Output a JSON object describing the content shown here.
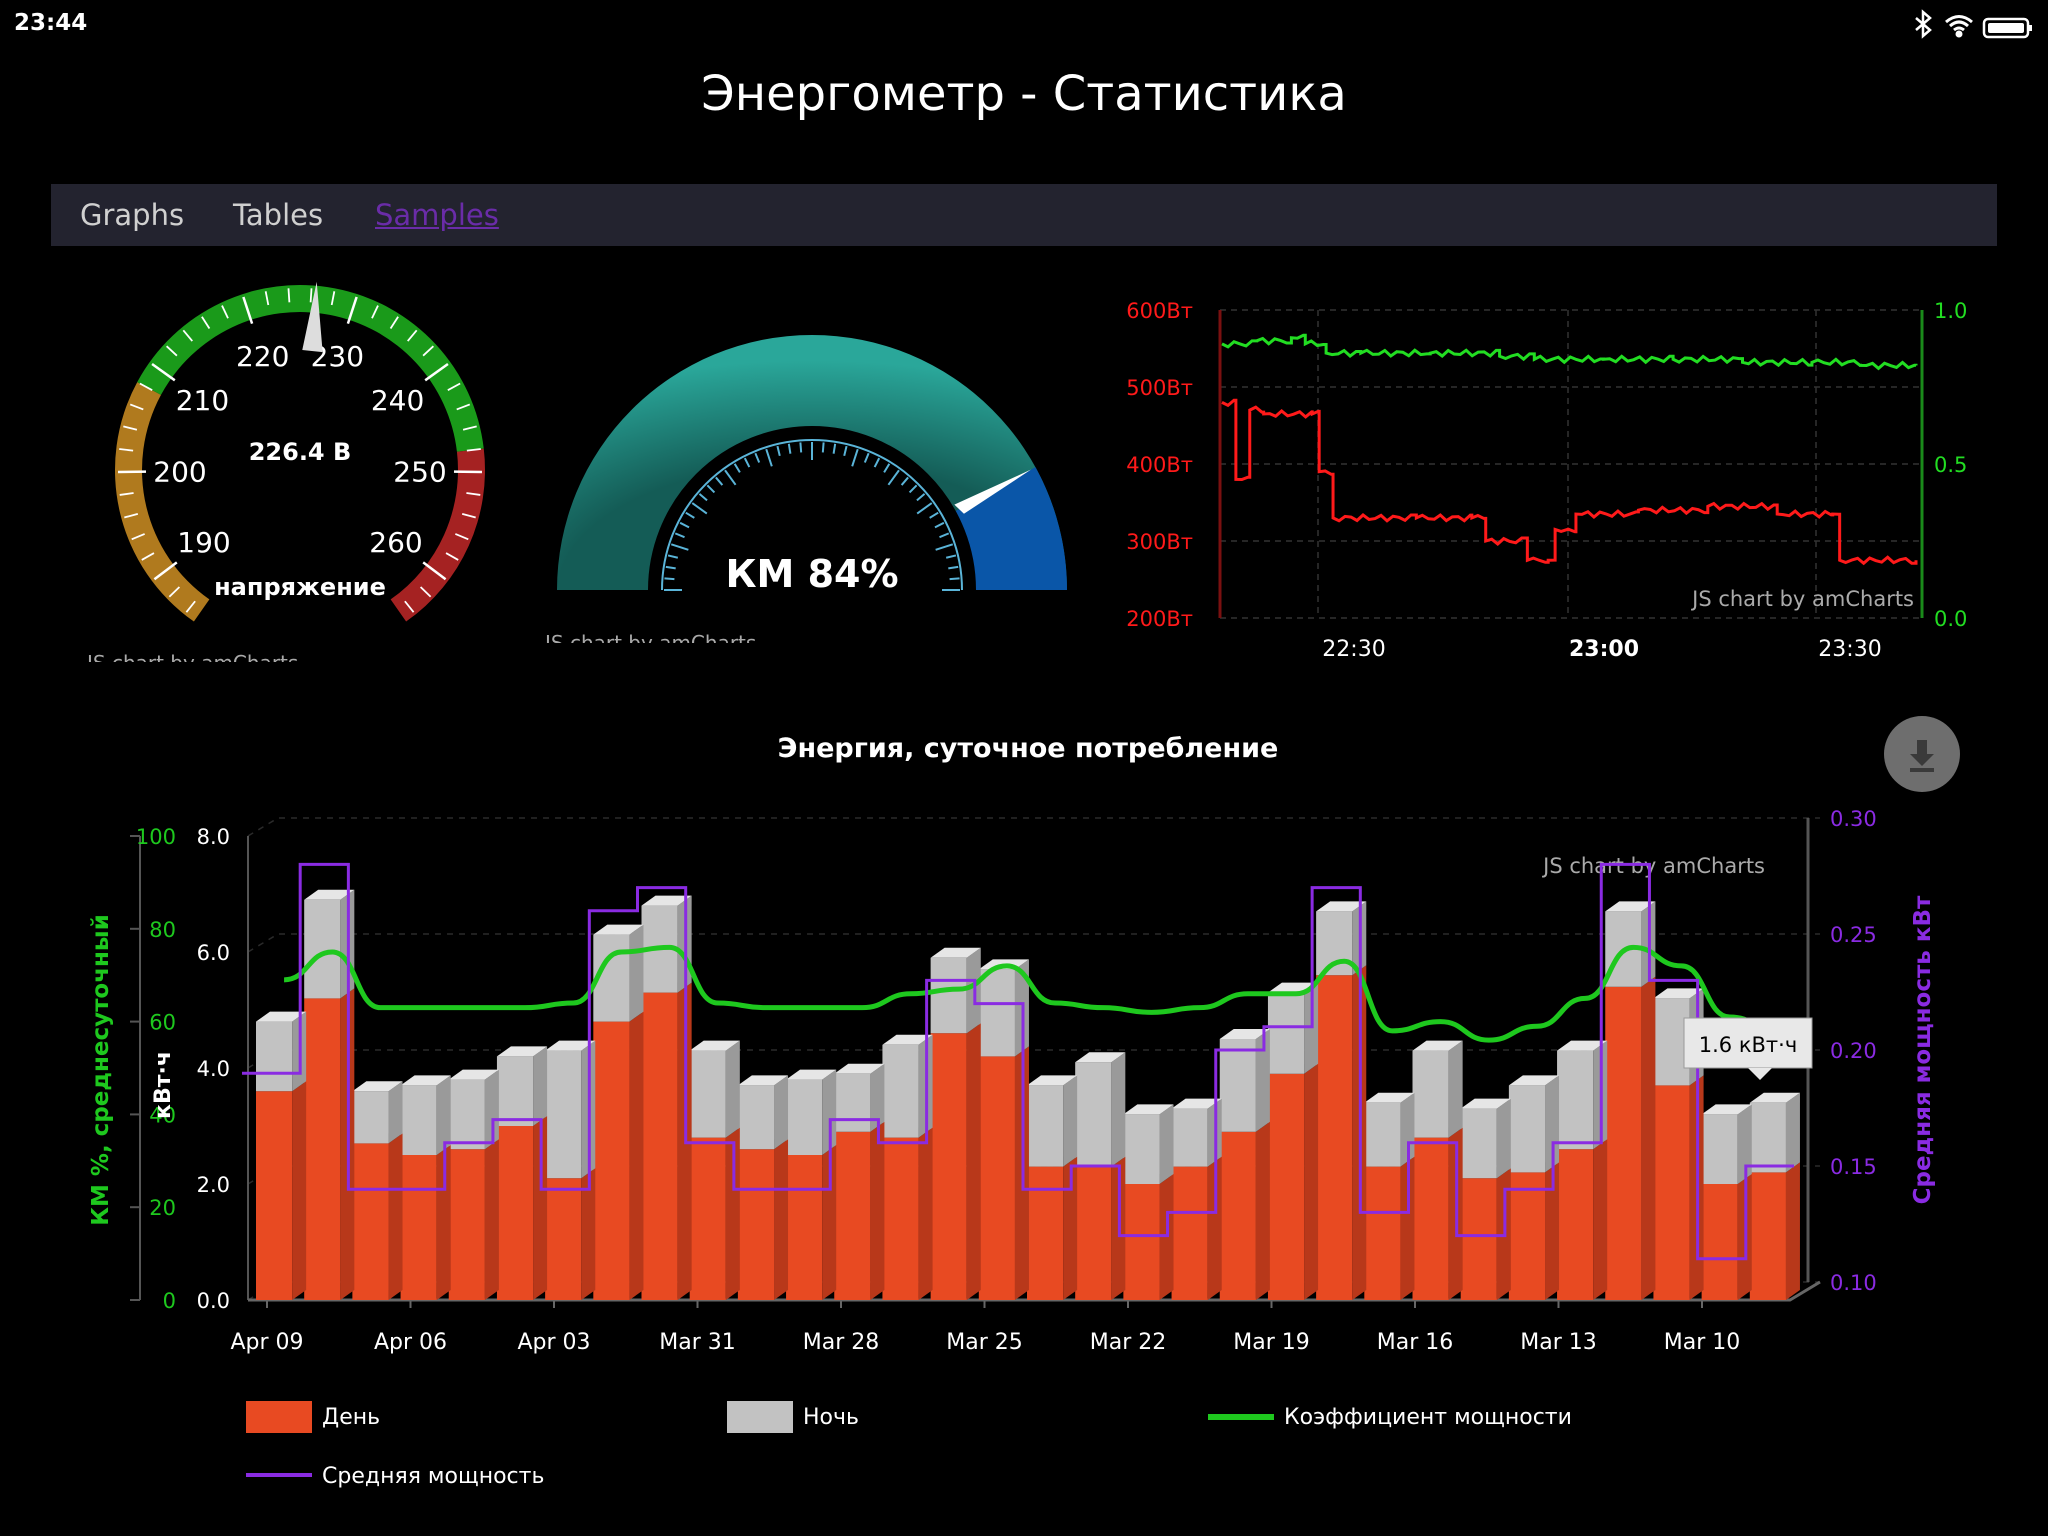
{
  "status_bar": {
    "time": "23:44"
  },
  "page": {
    "title": "Энергометр - Статистика"
  },
  "nav": {
    "tabs": [
      {
        "label": "Graphs"
      },
      {
        "label": "Tables"
      },
      {
        "label": "Samples"
      }
    ],
    "active": "Samples"
  },
  "colors": {
    "day": "#e84a22",
    "night": "#c2c2c2",
    "power_factor": "#1ec81e",
    "avg_power": "#8a2be2",
    "voltage_line": "#ff1a1a",
    "pf_line": "#22dd22"
  },
  "voltage_gauge": {
    "value_label": "226.4 В",
    "label": "напряжение",
    "watermark": "JS chart by amCharts",
    "ticks": [
      "190",
      "200",
      "210",
      "220",
      "230",
      "240",
      "250",
      "260"
    ],
    "value": 226.4,
    "min": 185,
    "max": 265
  },
  "km_gauge": {
    "label": "КМ 84%",
    "value": 84,
    "watermark": "JS chart by amCharts"
  },
  "live_chart": {
    "left_ticks": [
      "600Вт",
      "500Вт",
      "400Вт",
      "300Вт",
      "200Вт"
    ],
    "right_ticks": [
      "1.0",
      "0.5",
      "0.0"
    ],
    "x_ticks": [
      "22:30",
      "23:00",
      "23:30"
    ],
    "watermark": "JS chart by amCharts"
  },
  "main_chart": {
    "title": "Энергия, суточное потребление",
    "watermark": "JS chart by amCharts",
    "left_axis_label": "КМ %, среднесуточный",
    "left_ticks": [
      "100",
      "80",
      "60",
      "40",
      "20",
      "0"
    ],
    "kwh_axis_label": "кВт·ч",
    "kwh_ticks": [
      "8.0",
      "6.0",
      "4.0",
      "2.0",
      "0.0"
    ],
    "right_axis_label": "Средняя мощность кВт",
    "right_ticks": [
      "0.30",
      "0.25",
      "0.20",
      "0.15",
      "0.10"
    ],
    "tooltip": "1.6 кВт·ч",
    "legend": {
      "day": "День",
      "night": "Ночь",
      "power_factor": "Коэффициент мощности",
      "avg_power": "Средняя мощность"
    }
  },
  "chart_data": [
    {
      "type": "gauge",
      "title": "напряжение",
      "value": 226.4,
      "unit": "В",
      "range": [
        185,
        265
      ],
      "ticks": [
        190,
        200,
        210,
        220,
        230,
        240,
        250,
        260
      ]
    },
    {
      "type": "gauge",
      "title": "КМ",
      "value": 84,
      "unit": "%",
      "range": [
        0,
        100
      ]
    },
    {
      "type": "line",
      "x_ticks": [
        "22:30",
        "23:00",
        "23:30"
      ],
      "ylim_left": [
        200,
        600
      ],
      "ylim_right": [
        0.0,
        1.0
      ],
      "series": [
        {
          "axis": "right",
          "points": [
            [
              0,
              0.89
            ],
            [
              0.05,
              0.9
            ],
            [
              0.1,
              0.91
            ],
            [
              0.12,
              0.89
            ],
            [
              0.15,
              0.86
            ],
            [
              0.2,
              0.86
            ],
            [
              0.3,
              0.86
            ],
            [
              0.4,
              0.85
            ],
            [
              0.45,
              0.84
            ],
            [
              0.55,
              0.84
            ],
            [
              0.65,
              0.84
            ],
            [
              0.75,
              0.83
            ],
            [
              0.85,
              0.83
            ],
            [
              0.92,
              0.82
            ],
            [
              1,
              0.82
            ]
          ]
        },
        {
          "axis": "left",
          "points": [
            [
              0,
              480
            ],
            [
              0.02,
              380
            ],
            [
              0.04,
              470
            ],
            [
              0.06,
              465
            ],
            [
              0.13,
              465
            ],
            [
              0.14,
              390
            ],
            [
              0.16,
              330
            ],
            [
              0.28,
              330
            ],
            [
              0.36,
              330
            ],
            [
              0.38,
              300
            ],
            [
              0.44,
              275
            ],
            [
              0.47,
              275
            ],
            [
              0.48,
              315
            ],
            [
              0.5,
              315
            ],
            [
              0.51,
              335
            ],
            [
              0.6,
              340
            ],
            [
              0.7,
              345
            ],
            [
              0.8,
              335
            ],
            [
              0.88,
              335
            ],
            [
              0.89,
              275
            ],
            [
              1,
              275
            ]
          ]
        }
      ]
    },
    {
      "type": "bar",
      "title": "Энергия, суточное потребление",
      "categories": [
        "Apr 09",
        "Apr 06",
        "Apr 03",
        "Mar 31",
        "Mar 28",
        "Mar 25",
        "Mar 22",
        "Mar 19",
        "Mar 16",
        "Mar 13",
        "Mar 10"
      ],
      "ylim": [
        0,
        8
      ],
      "ylim_pf": [
        0,
        100
      ],
      "ylim_avg_power": [
        0.1,
        0.3
      ],
      "stacked": true,
      "series": [
        {
          "name": "День",
          "values": [
            3.6,
            5.2,
            2.7,
            2.5,
            2.6,
            3.0,
            2.1,
            4.8,
            5.3,
            2.8,
            2.6,
            2.5,
            2.9,
            2.8,
            4.6,
            4.2,
            2.3,
            2.3,
            2.0,
            2.3,
            2.9,
            3.9,
            5.6,
            2.3,
            2.8,
            2.1,
            2.2,
            2.6,
            5.4,
            3.7,
            2.0,
            2.2
          ]
        },
        {
          "name": "Ночь",
          "values": [
            1.2,
            1.7,
            0.9,
            1.2,
            1.2,
            1.2,
            2.2,
            1.5,
            1.5,
            1.5,
            1.1,
            1.3,
            1.0,
            1.6,
            1.3,
            1.5,
            1.4,
            1.8,
            1.2,
            1.0,
            1.6,
            1.4,
            1.1,
            1.1,
            1.5,
            1.2,
            1.5,
            1.7,
            1.3,
            1.5,
            1.2,
            1.2
          ]
        },
        {
          "name": "Коэффициент мощности",
          "values": [
            69,
            75,
            63,
            63,
            63,
            63,
            64,
            75,
            76,
            64,
            63,
            63,
            63,
            66,
            67,
            72,
            64,
            63,
            62,
            63,
            66,
            66,
            73,
            58,
            60,
            56,
            59,
            65,
            76,
            72,
            61,
            58
          ]
        },
        {
          "name": "Средняя мощность",
          "values": [
            0.19,
            0.28,
            0.14,
            0.14,
            0.16,
            0.17,
            0.14,
            0.26,
            0.27,
            0.16,
            0.14,
            0.14,
            0.17,
            0.16,
            0.23,
            0.22,
            0.14,
            0.15,
            0.12,
            0.13,
            0.2,
            0.21,
            0.27,
            0.13,
            0.16,
            0.12,
            0.14,
            0.16,
            0.28,
            0.23,
            0.11,
            0.15
          ]
        }
      ]
    }
  ]
}
